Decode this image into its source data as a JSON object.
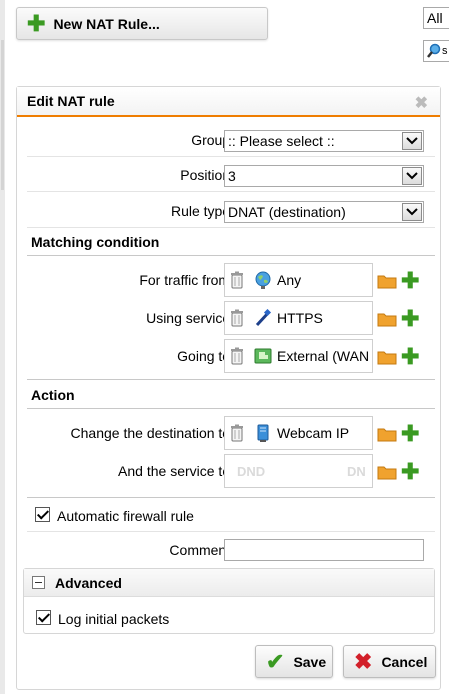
{
  "toolbar": {
    "new_rule_label": "New NAT Rule..."
  },
  "filter": {
    "value": "All"
  },
  "search": {
    "value": "s"
  },
  "dialog": {
    "title": "Edit NAT rule",
    "group": {
      "label": "Group:",
      "value": ":: Please select ::"
    },
    "position": {
      "label": "Position:",
      "value": "3"
    },
    "rule_type": {
      "label": "Rule type:",
      "value": "DNAT (destination)"
    },
    "matching": {
      "title": "Matching condition",
      "traffic_from": {
        "label": "For traffic from:",
        "value": "Any"
      },
      "service": {
        "label": "Using service:",
        "value": "HTTPS"
      },
      "going_to": {
        "label": "Going to:",
        "value": "External (WAN"
      }
    },
    "action": {
      "title": "Action",
      "change_dest": {
        "label": "Change the destination to:",
        "value": "Webcam IP"
      },
      "service_to": {
        "label": "And the service to:",
        "placeholder_left": "DND",
        "placeholder_right": "DN"
      }
    },
    "auto_firewall": {
      "label": "Automatic firewall rule",
      "checked": true
    },
    "comment": {
      "label": "Comment:",
      "value": ""
    },
    "advanced": {
      "title": "Advanced",
      "log_initial": {
        "label": "Log initial packets",
        "checked": true
      }
    },
    "save_label": "Save",
    "cancel_label": "Cancel"
  },
  "colors": {
    "accent": "#ef7d00",
    "plus_green": "#3a9a22",
    "cancel_red": "#d2202a",
    "folder_orange": "#f0a22e"
  }
}
